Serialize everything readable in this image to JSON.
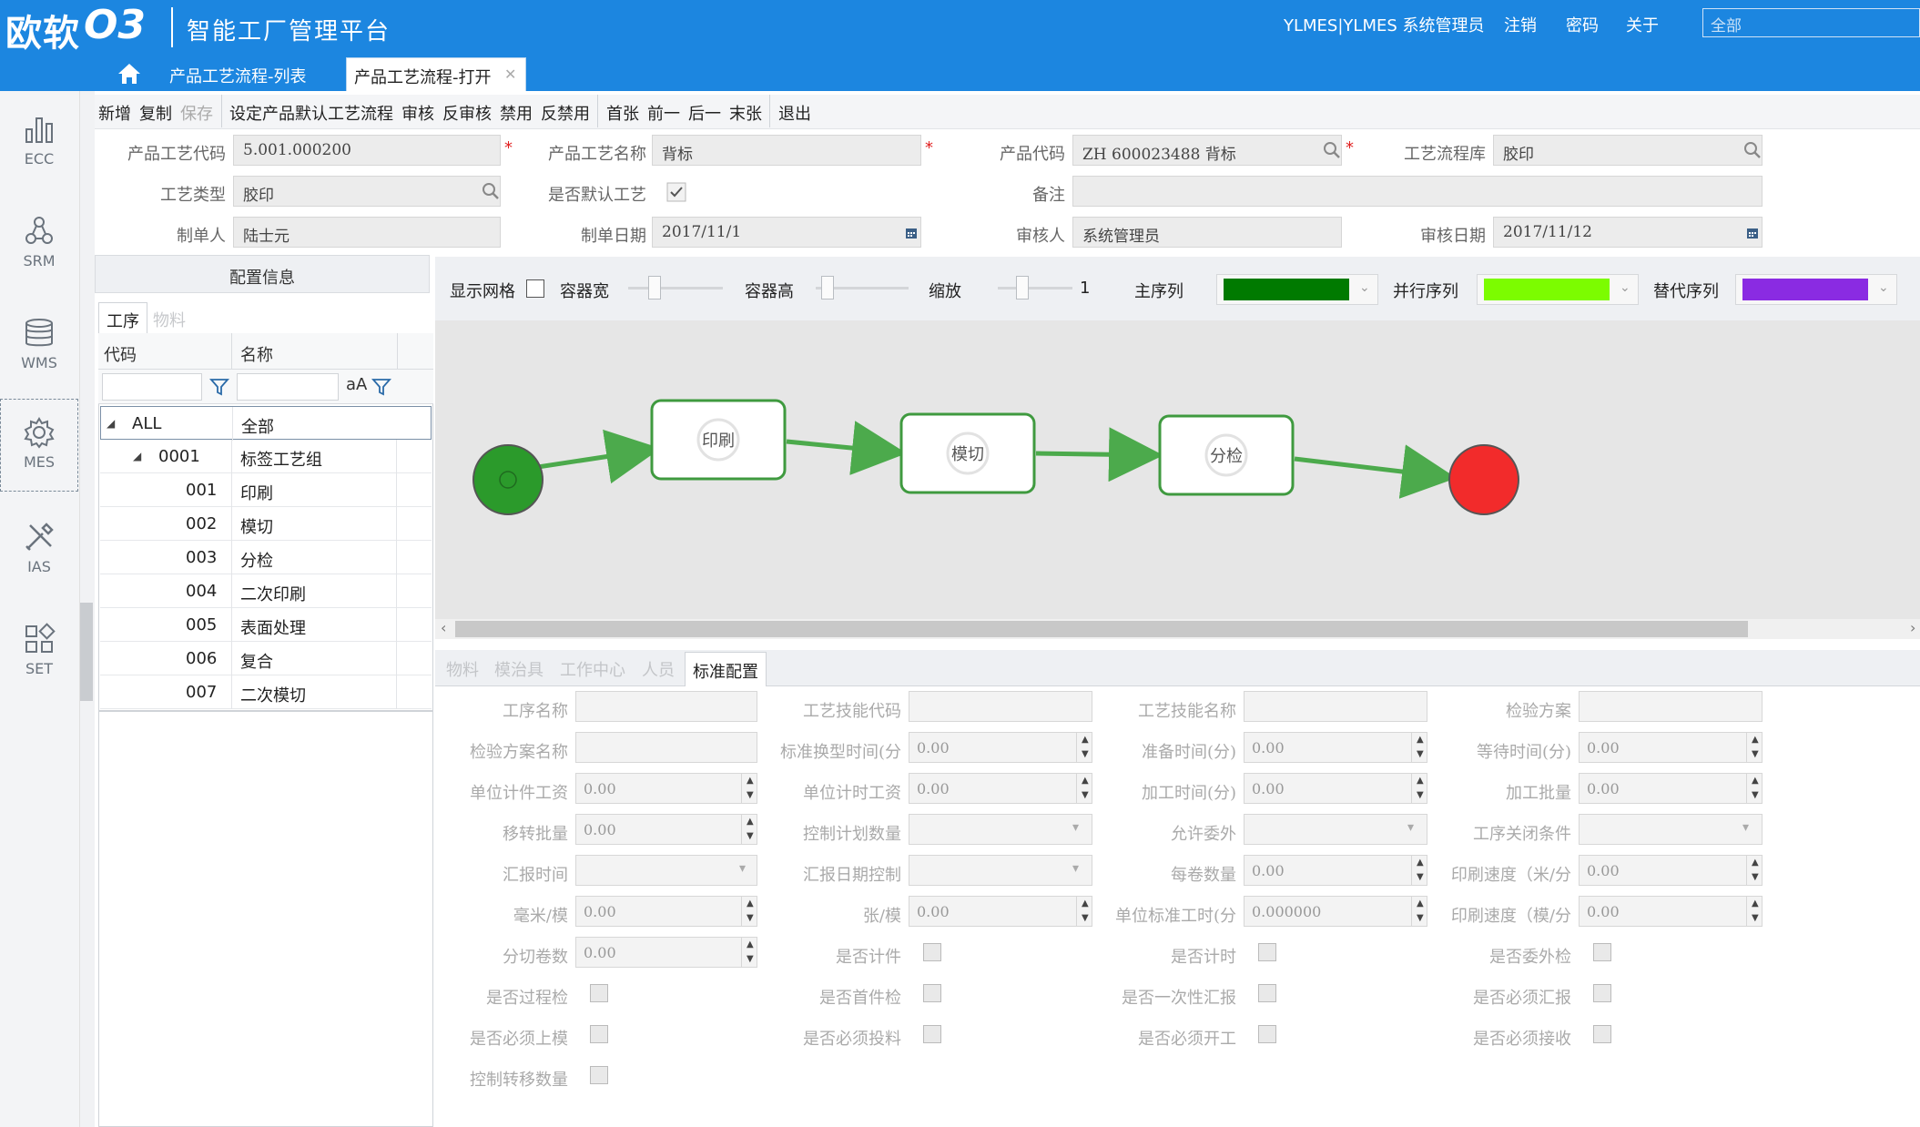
{
  "header": {
    "logo_text": "欧软",
    "logo_mark": "O3",
    "app_title": "智能工厂管理平台",
    "user": "YLMES|YLMES 系统管理员",
    "logout": "注销",
    "password": "密码",
    "about": "关于",
    "search_placeholder": "全部",
    "color": "#1c86e0"
  },
  "tabs": [
    {
      "label": "产品工艺流程-列表"
    },
    {
      "label": "产品工艺流程-打开"
    }
  ],
  "nav": [
    {
      "label": "ECC",
      "icon": "bar-chart-icon"
    },
    {
      "label": "SRM",
      "icon": "network-icon"
    },
    {
      "label": "WMS",
      "icon": "database-icon"
    },
    {
      "label": "MES",
      "icon": "gear-icon"
    },
    {
      "label": "IAS",
      "icon": "tools-icon"
    },
    {
      "label": "SET",
      "icon": "grid-icon"
    }
  ],
  "toolbar": {
    "add": "新增",
    "copy": "复制",
    "save": "保存",
    "set_default": "设定产品默认工艺流程",
    "audit": "审核",
    "unaudit": "反审核",
    "disable": "禁用",
    "undisable": "反禁用",
    "first": "首张",
    "prev": "前一",
    "next": "后一",
    "last": "末张",
    "exit": "退出"
  },
  "form": {
    "process_code_label": "产品工艺代码",
    "process_code": "5.001.000200",
    "process_name_label": "产品工艺名称",
    "process_name": "背标",
    "product_code_label": "产品代码",
    "product_code": "ZH 600023488 背标",
    "library_label": "工艺流程库",
    "library": "胶印",
    "type_label": "工艺类型",
    "type": "胶印",
    "default_label": "是否默认工艺",
    "remark_label": "备注",
    "creator_label": "制单人",
    "creator": "陆士元",
    "create_date_label": "制单日期",
    "create_date": "2017/11/1",
    "auditor_label": "审核人",
    "auditor": "系统管理员",
    "audit_date_label": "审核日期",
    "audit_date": "2017/11/12",
    "required_mark": "*"
  },
  "config": {
    "header": "配置信息",
    "tab_process": "工序",
    "tab_material": "物料",
    "col_code": "代码",
    "col_name": "名称",
    "case_toggle": "aA",
    "rows": [
      {
        "code": "ALL",
        "name": "全部"
      },
      {
        "code": "0001",
        "name": "标签工艺组"
      },
      {
        "code": "001",
        "name": "印刷"
      },
      {
        "code": "002",
        "name": "模切"
      },
      {
        "code": "003",
        "name": "分检"
      },
      {
        "code": "004",
        "name": "二次印刷"
      },
      {
        "code": "005",
        "name": "表面处理"
      },
      {
        "code": "006",
        "name": "复合"
      },
      {
        "code": "007",
        "name": "二次模切"
      }
    ]
  },
  "flowbar": {
    "show_grid": "显示网格",
    "width": "容器宽",
    "height": "容器高",
    "zoom": "缩放",
    "zoom_value": "1",
    "main_seq": "主序列",
    "parallel_seq": "并行序列",
    "alt_seq": "替代序列",
    "main_color": "#007a00",
    "parallel_color": "#7cfc00",
    "alt_color": "#8a2be2"
  },
  "flow": {
    "nodes": [
      {
        "label": "印刷"
      },
      {
        "label": "模切"
      },
      {
        "label": "分检"
      }
    ],
    "start_color": "#2b9a2b",
    "end_color": "#f22b2b",
    "edge_color": "#4caa4c"
  },
  "detail_tabs": {
    "material": "物料",
    "mold": "模治具",
    "workcenter": "工作中心",
    "staff": "人员",
    "standard": "标准配置"
  },
  "detail": {
    "f1": {
      "label": "工序名称",
      "value": ""
    },
    "f2": {
      "label": "工艺技能代码",
      "value": ""
    },
    "f3": {
      "label": "工艺技能名称",
      "value": ""
    },
    "f4": {
      "label": "检验方案",
      "value": ""
    },
    "f5": {
      "label": "检验方案名称",
      "value": ""
    },
    "f6": {
      "label": "标准换型时间(分",
      "value": "0.00"
    },
    "f7": {
      "label": "准备时间(分)",
      "value": "0.00"
    },
    "f8": {
      "label": "等待时间(分)",
      "value": "0.00"
    },
    "f9": {
      "label": "单位计件工资",
      "value": "0.00"
    },
    "f10": {
      "label": "单位计时工资",
      "value": "0.00"
    },
    "f11": {
      "label": "加工时间(分)",
      "value": "0.00"
    },
    "f12": {
      "label": "加工批量",
      "value": "0.00"
    },
    "f13": {
      "label": "移转批量",
      "value": "0.00"
    },
    "f14": {
      "label": "控制计划数量",
      "value": ""
    },
    "f15": {
      "label": "允许委外",
      "value": ""
    },
    "f16": {
      "label": "工序关闭条件",
      "value": ""
    },
    "f17": {
      "label": "汇报时间",
      "value": ""
    },
    "f18": {
      "label": "汇报日期控制",
      "value": ""
    },
    "f19": {
      "label": "每卷数量",
      "value": "0.00"
    },
    "f20": {
      "label": "印刷速度（米/分",
      "value": "0.00"
    },
    "f21": {
      "label": "毫米/模",
      "value": "0.00"
    },
    "f22": {
      "label": "张/模",
      "value": "0.00"
    },
    "f23": {
      "label": "单位标准工时(分",
      "value": "0.000000"
    },
    "f24": {
      "label": "印刷速度（模/分",
      "value": "0.00"
    },
    "f25": {
      "label": "分切卷数",
      "value": "0.00"
    },
    "c1": "是否计件",
    "c2": "是否计时",
    "c3": "是否委外检",
    "c4": "是否过程检",
    "c5": "是否首件检",
    "c6": "是否一次性汇报",
    "c7": "是否必须汇报",
    "c8": "是否必须上模",
    "c9": "是否必须投料",
    "c10": "是否必须开工",
    "c11": "是否必须接收",
    "c12": "控制转移数量"
  }
}
